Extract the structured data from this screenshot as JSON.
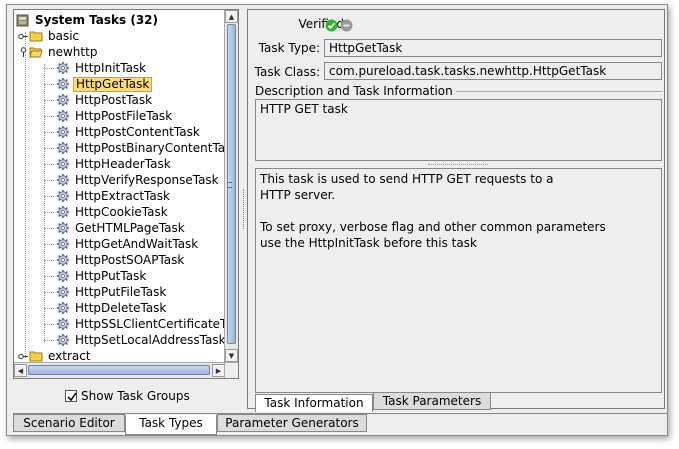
{
  "tree": {
    "root_label": "System Tasks (32)",
    "folders": [
      {
        "label": "basic",
        "expanded": false
      },
      {
        "label": "newhttp",
        "expanded": true
      },
      {
        "label": "extract",
        "expanded": false
      }
    ],
    "tasks": [
      "HttpInitTask",
      "HttpGetTask",
      "HttpPostTask",
      "HttpPostFileTask",
      "HttpPostContentTask",
      "HttpPostBinaryContentTask",
      "HttpHeaderTask",
      "HttpVerifyResponseTask",
      "HttpExtractTask",
      "HttpCookieTask",
      "GetHTMLPageTask",
      "HttpGetAndWaitTask",
      "HttpPostSOAPTask",
      "HttpPutTask",
      "HttpPutFileTask",
      "HttpDeleteTask",
      "HttpSSLClientCertificateTask",
      "HttpSetLocalAddressTask"
    ],
    "selected_task": "HttpGetTask",
    "show_task_groups_label": "Show Task Groups",
    "show_task_groups_checked": true
  },
  "details": {
    "verified_label": "Verified:",
    "task_type_label": "Task Type:",
    "task_type_value": "HttpGetTask",
    "task_class_label": "Task Class:",
    "task_class_value": "com.pureload.task.tasks.newhttp.HttpGetTask",
    "description_section_label": "Description and Task Information",
    "description_text": "HTTP GET task",
    "info_text": "This task is used to send HTTP GET requests to a\nHTTP server.\n\nTo set proxy, verbose flag and other common parameters\nuse the HttpInitTask before this task",
    "verified_ok_color": "#2db52d",
    "verified_unknown_color": "#9a9a9a"
  },
  "detail_tabs": [
    {
      "label": "Task Information",
      "active": true
    },
    {
      "label": "Task Parameters",
      "active": false
    }
  ],
  "bottom_tabs": [
    {
      "label": "Scenario Editor",
      "active": false
    },
    {
      "label": "Task Types",
      "active": true
    },
    {
      "label": "Parameter Generators",
      "active": false
    }
  ]
}
